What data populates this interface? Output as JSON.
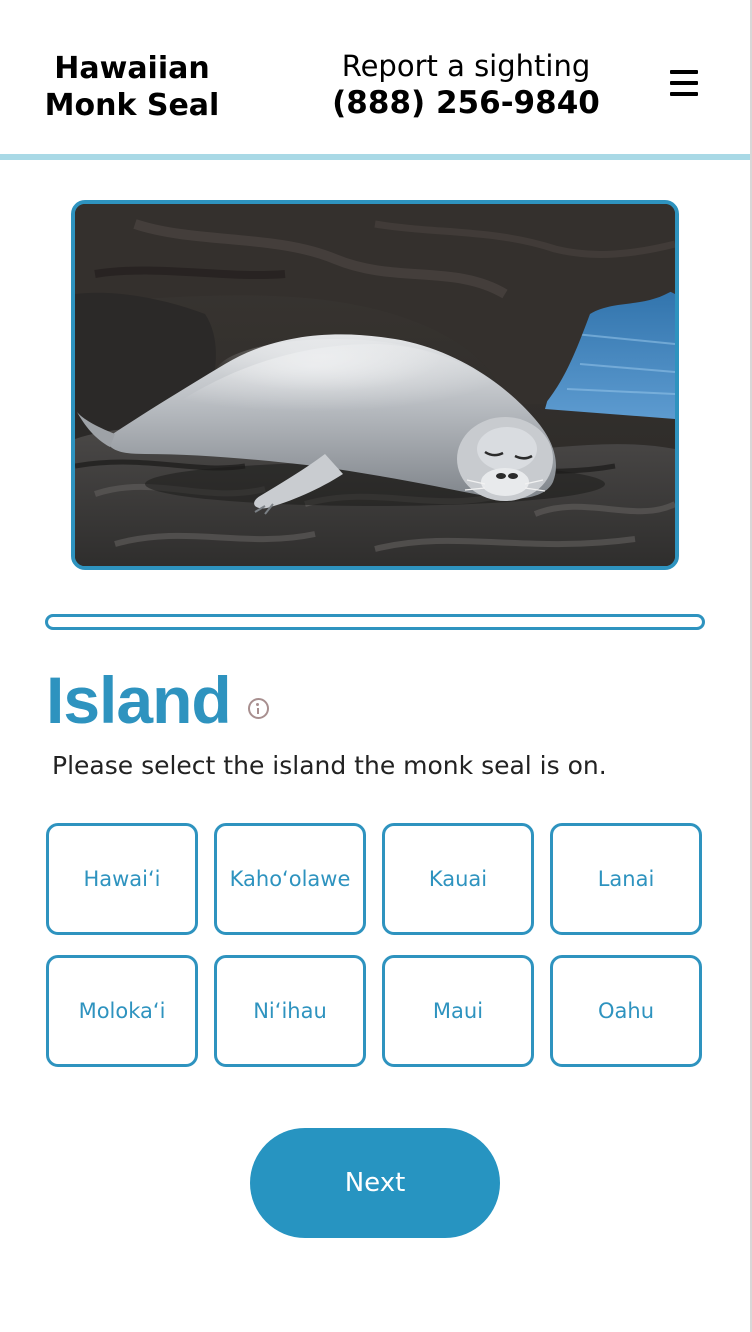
{
  "header": {
    "brand_line1": "Hawaiian",
    "brand_line2": "Monk Seal",
    "report_label": "Report a sighting",
    "report_phone": "(888) 256-9840",
    "menu_icon": "hamburger-menu-icon"
  },
  "photo": {
    "alt": "Hawaiian monk seal resting on dark lava rocks"
  },
  "progress": {
    "fraction": 0.0
  },
  "question": {
    "title": "Island",
    "info_icon": "info-icon",
    "prompt": "Please select the island the monk seal is on."
  },
  "islands": [
    {
      "label": "Hawai‘i"
    },
    {
      "label": "Kaho‘olawe"
    },
    {
      "label": "Kauai"
    },
    {
      "label": "Lanai"
    },
    {
      "label": "Moloka‘i"
    },
    {
      "label": "Ni‘ihau"
    },
    {
      "label": "Maui"
    },
    {
      "label": "Oahu"
    }
  ],
  "actions": {
    "next_label": "Next"
  },
  "colors": {
    "accent": "#2e93bf",
    "header_rule": "#a9d9e6",
    "info_icon": "#a88f8f"
  }
}
